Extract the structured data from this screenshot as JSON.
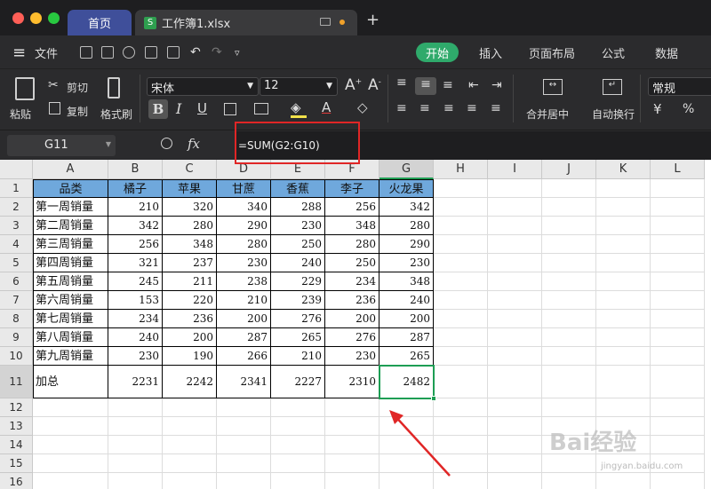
{
  "window": {
    "close_color": "#ff5f57",
    "min_color": "#febc2e",
    "max_color": "#28c840"
  },
  "tabs": {
    "home": "首页",
    "file": "工作簿1.xlsx",
    "new_tab": "+"
  },
  "menu": {
    "hamburger": "≡",
    "file": "文件",
    "start": "开始",
    "insert": "插入",
    "page_layout": "页面布局",
    "formula": "公式",
    "data": "数据"
  },
  "toolbar": {
    "paste": "粘贴",
    "cut": "剪切",
    "copy": "复制",
    "format_painter": "格式刷",
    "font_name": "宋体",
    "font_size": "12",
    "bold": "B",
    "italic": "I",
    "underline": "U",
    "merge_center": "合并居中",
    "wrap_text": "自动换行",
    "number_format": "常规",
    "currency": "¥",
    "percent": "%"
  },
  "formula_bar": {
    "cell_ref": "G11",
    "fx": "fx",
    "formula": "=SUM(G2:G10)"
  },
  "sheet": {
    "columns": [
      "A",
      "B",
      "C",
      "D",
      "E",
      "F",
      "G",
      "H",
      "I",
      "J",
      "K",
      "L"
    ],
    "rows": [
      "1",
      "2",
      "3",
      "4",
      "5",
      "6",
      "7",
      "8",
      "9",
      "10",
      "11",
      "12",
      "13",
      "14",
      "15",
      "16"
    ],
    "header": [
      "品类",
      "橘子",
      "苹果",
      "甘蔗",
      "香蕉",
      "李子",
      "火龙果"
    ],
    "data": [
      [
        "第一周销量",
        "210",
        "320",
        "340",
        "288",
        "256",
        "342"
      ],
      [
        "第二周销量",
        "342",
        "280",
        "290",
        "230",
        "348",
        "280"
      ],
      [
        "第三周销量",
        "256",
        "348",
        "280",
        "250",
        "280",
        "290"
      ],
      [
        "第四周销量",
        "321",
        "237",
        "230",
        "240",
        "250",
        "230"
      ],
      [
        "第五周销量",
        "245",
        "211",
        "238",
        "229",
        "234",
        "348"
      ],
      [
        "第六周销量",
        "153",
        "220",
        "210",
        "239",
        "236",
        "240"
      ],
      [
        "第七周销量",
        "234",
        "236",
        "200",
        "276",
        "200",
        "200"
      ],
      [
        "第八周销量",
        "240",
        "200",
        "287",
        "265",
        "276",
        "287"
      ],
      [
        "第九周销量",
        "230",
        "190",
        "266",
        "210",
        "230",
        "265"
      ],
      [
        "加总",
        "2231",
        "2242",
        "2341",
        "2227",
        "2310",
        "2482"
      ]
    ],
    "active_cell": "G11",
    "header_fill": "#6fa8dc",
    "selection_color": "#1e9e54"
  },
  "watermark": {
    "text": "Bai经验",
    "url": "jingyan.baidu.com"
  }
}
